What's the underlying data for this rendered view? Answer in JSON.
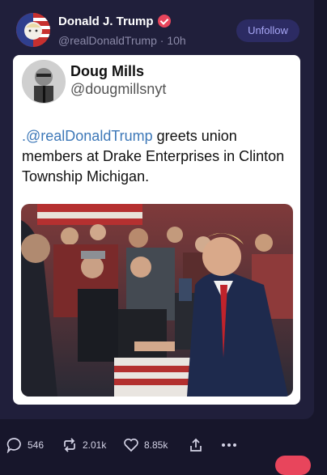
{
  "post": {
    "author_name": "Donald J. Trump",
    "author_handle": "@realDonaldTrump",
    "time": "10h",
    "follow_button": "Unfollow"
  },
  "quote": {
    "name": "Doug Mills",
    "handle": "@dougmillsnyt",
    "mention": ".@realDonaldTrump",
    "text_rest": " greets union members at Drake Enterprises in Clinton Township Michigan."
  },
  "actions": {
    "replies": "546",
    "reposts": "2.01k",
    "likes": "8.85k"
  },
  "icons": {
    "verified": "verified-badge-icon",
    "reply": "speech-bubble-icon",
    "repost": "repost-arrows-icon",
    "like": "heart-icon",
    "share": "share-upload-icon",
    "more": "ellipsis-icon"
  },
  "colors": {
    "background": "#17162b",
    "card": "#201f3b",
    "accent": "#a7a6f5",
    "mention": "#3d78b8",
    "verified": "#e8455c"
  }
}
